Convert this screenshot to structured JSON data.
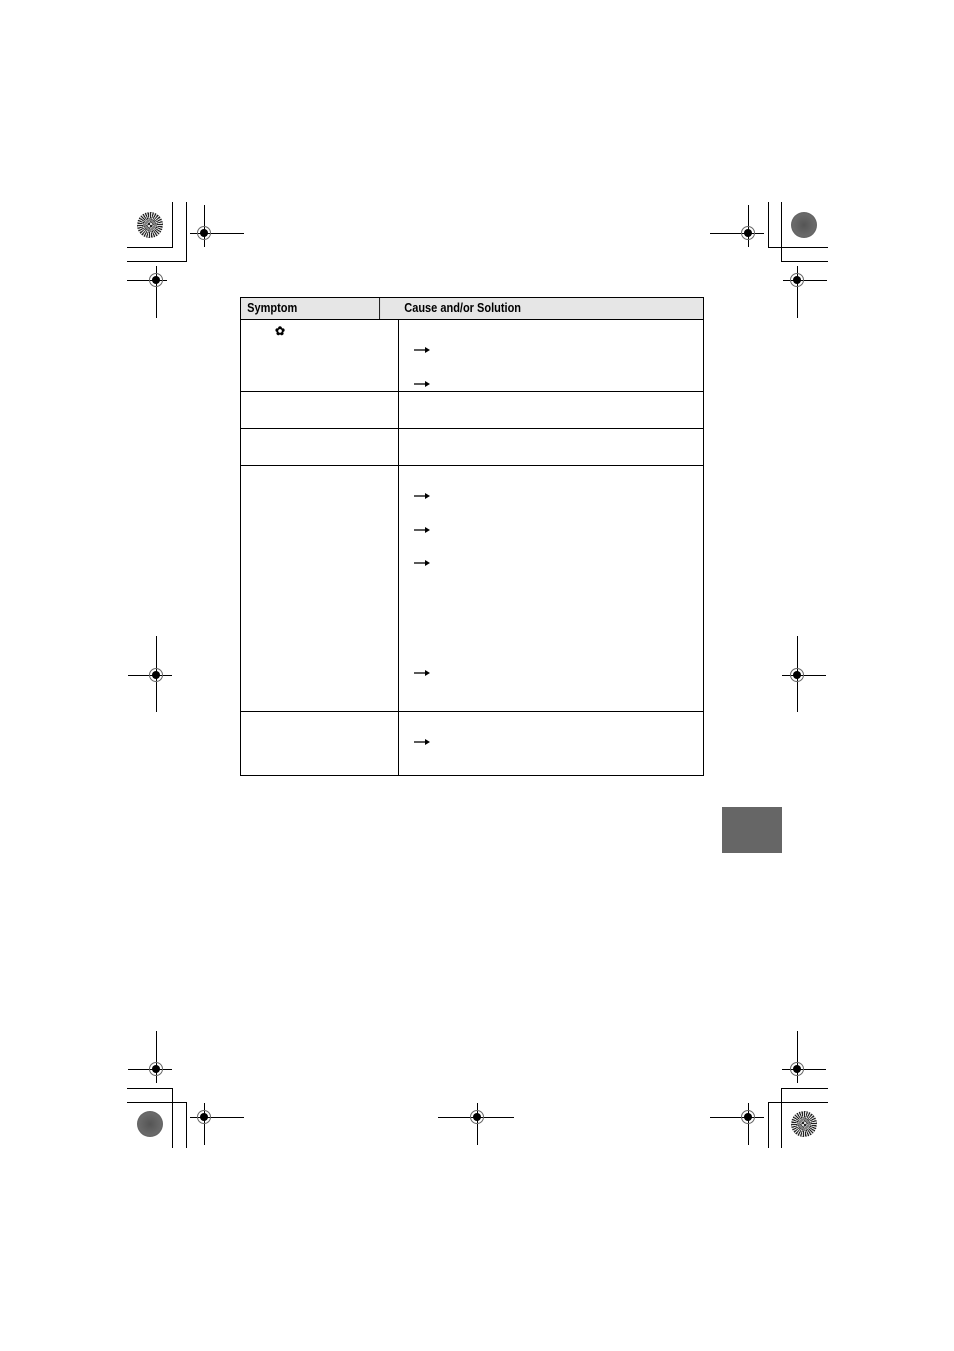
{
  "table": {
    "headers": {
      "symptom": "Symptom",
      "solution": "Cause and/or Solution"
    },
    "rows": [
      {
        "symptom_icon": "macro-flower-icon",
        "symptom_text": "",
        "solution_arrows": 2,
        "solution_text": ""
      },
      {
        "symptom_text": "",
        "solution_arrows": 0,
        "solution_text": ""
      },
      {
        "symptom_text": "",
        "solution_arrows": 0,
        "solution_text": ""
      },
      {
        "symptom_text": "",
        "solution_arrows": 4,
        "solution_text": ""
      },
      {
        "symptom_text": "",
        "solution_arrows": 1,
        "solution_text": ""
      }
    ]
  },
  "icons": {
    "macro": "✿",
    "arrow": "→"
  },
  "colors": {
    "header_bg": "#e6e6e6",
    "tab_marker": "#666666",
    "border": "#000000"
  }
}
